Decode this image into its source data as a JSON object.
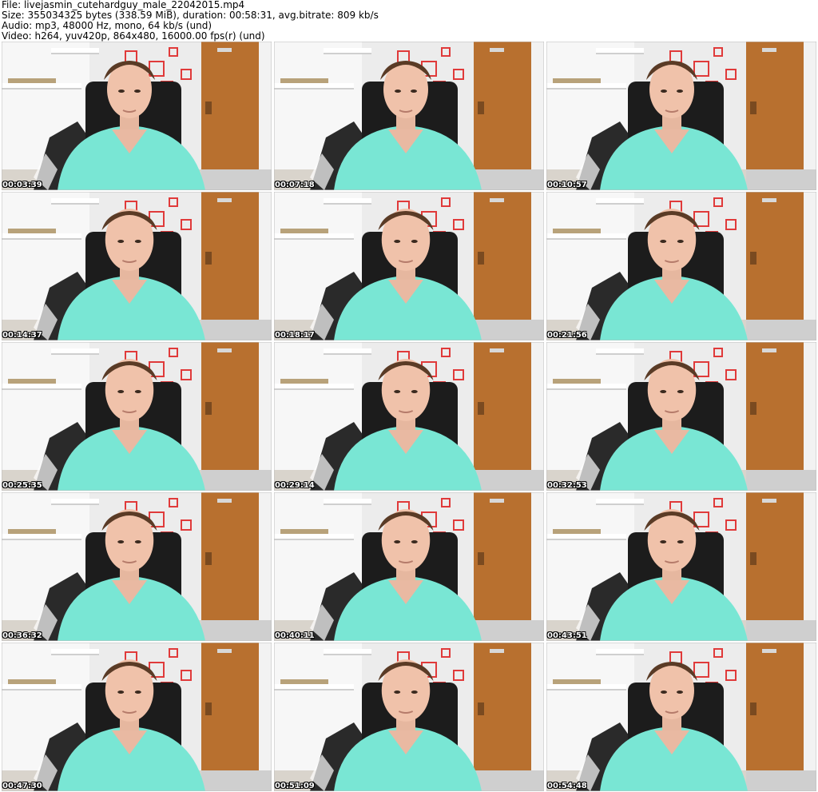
{
  "info": {
    "file_line": "File: livejasmin_cutehardguy_male_22042015.mp4",
    "size_line": "Size: 355034325 bytes (338.59 MiB), duration: 00:58:31, avg.bitrate: 809 kb/s",
    "audio_line": "Audio: mp3, 48000 Hz, mono, 64 kb/s (und)",
    "video_line": "Video: h264, yuv420p, 864x480, 16000.00 fps(r) (und)"
  },
  "frames": [
    {
      "timestamp": "00:03:39"
    },
    {
      "timestamp": "00:07:18"
    },
    {
      "timestamp": "00:10:57"
    },
    {
      "timestamp": "00:14:37"
    },
    {
      "timestamp": "00:18:17"
    },
    {
      "timestamp": "00:21:56"
    },
    {
      "timestamp": "00:25:35"
    },
    {
      "timestamp": "00:29:14"
    },
    {
      "timestamp": "00:32:53"
    },
    {
      "timestamp": "00:36:32"
    },
    {
      "timestamp": "00:40:11"
    },
    {
      "timestamp": "00:43:51"
    },
    {
      "timestamp": "00:47:30"
    },
    {
      "timestamp": "00:51:09"
    },
    {
      "timestamp": "00:54:48"
    }
  ],
  "colors": {
    "shirt": "#79e6d4",
    "door": "#b8702f",
    "wall": "#ececec",
    "chair": "#1c1c1c"
  }
}
